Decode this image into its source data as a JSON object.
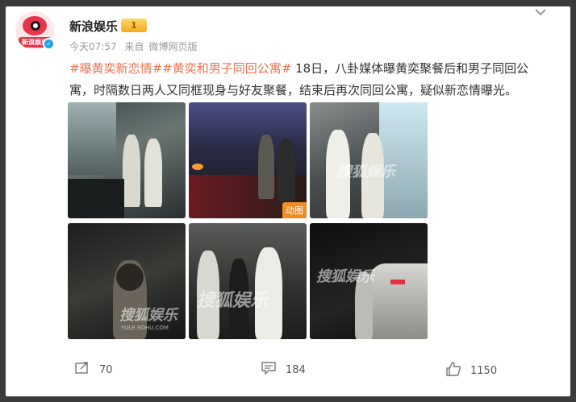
{
  "post": {
    "username": "新浪娱乐",
    "vip_level": "1",
    "avatar_text": "新浪娱乐",
    "time": "今天07:57",
    "source_prefix": "来自",
    "source": "微博网页版",
    "hashtag1": "#曝黄奕新恋情#",
    "hashtag2": "#黄奕和男子同回公寓#",
    "body": " 18日，八卦媒体曝黄奕聚餐后和男子同回公寓，时隔数日两人又同框现身与好友聚餐，结束后再次同回公寓，疑似新恋情曝光。"
  },
  "photos": {
    "gif_badge": "动图",
    "watermark": "搜狐娱乐",
    "watermark_url": "YULE.SOHU.COM"
  },
  "actions": {
    "repost_count": "70",
    "comment_count": "184",
    "like_count": "1150"
  },
  "icons": [
    "verified-icon",
    "vip-badge-icon",
    "chevron-down-icon",
    "repost-icon",
    "comment-icon",
    "like-icon"
  ]
}
